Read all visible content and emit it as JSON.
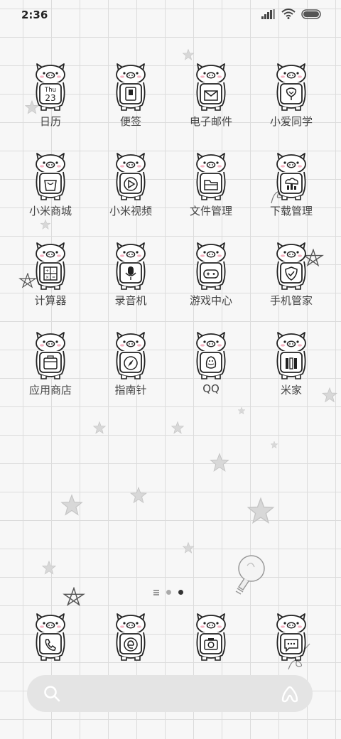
{
  "status_bar": {
    "time": "2:36"
  },
  "calendar_icon": {
    "weekday": "Thu",
    "day": "23"
  },
  "apps": [
    {
      "label": "日历"
    },
    {
      "label": "便签"
    },
    {
      "label": "电子邮件"
    },
    {
      "label": "小爱同学"
    },
    {
      "label": "小米商城"
    },
    {
      "label": "小米视频"
    },
    {
      "label": "文件管理"
    },
    {
      "label": "下载管理"
    },
    {
      "label": "计算器"
    },
    {
      "label": "录音机"
    },
    {
      "label": "游戏中心"
    },
    {
      "label": "手机管家"
    },
    {
      "label": "应用商店"
    },
    {
      "label": "指南针"
    },
    {
      "label": "QQ"
    },
    {
      "label": "米家"
    }
  ],
  "page_indicator": {
    "count": 2,
    "active": 2
  },
  "dock": [
    "phone",
    "browser",
    "camera",
    "messages"
  ]
}
